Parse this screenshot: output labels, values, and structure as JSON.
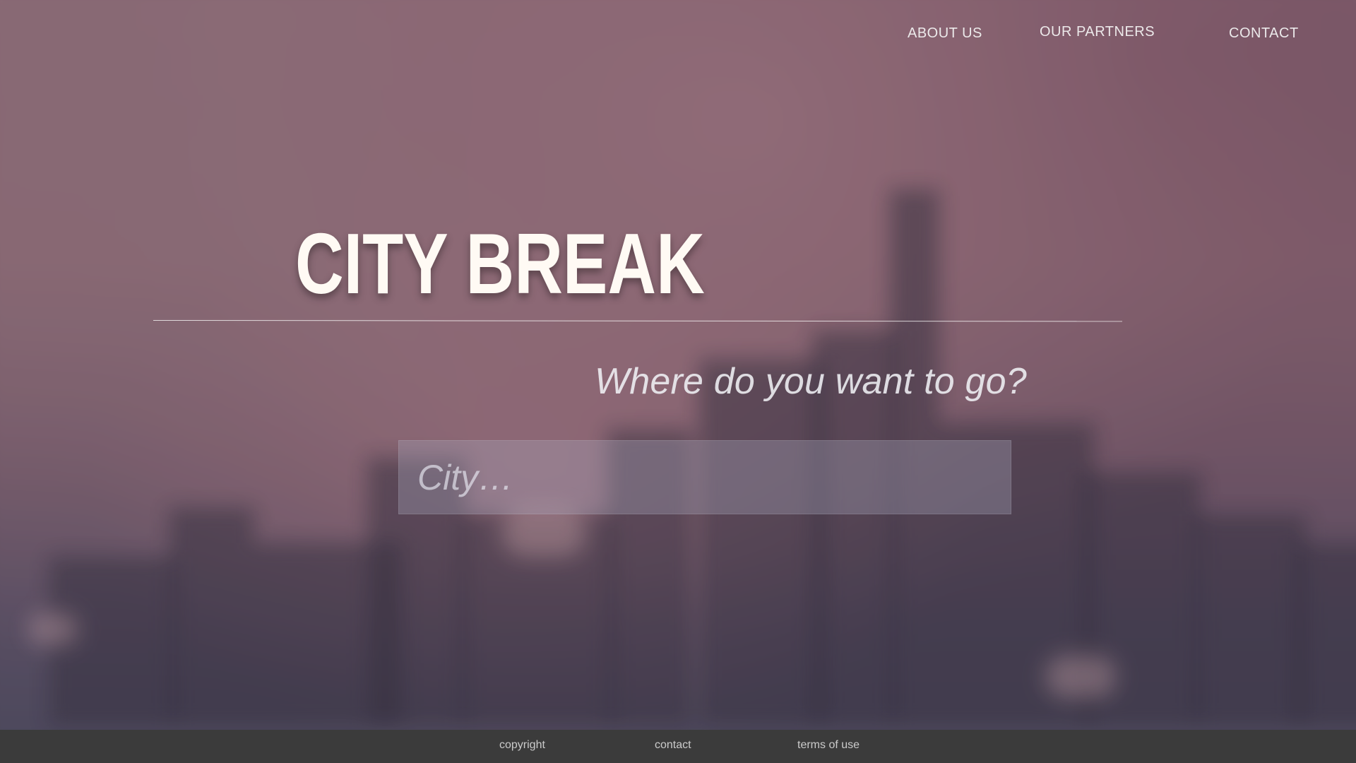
{
  "nav": {
    "items": [
      {
        "label": "ABOUT US"
      },
      {
        "label": "OUR PARTNERS"
      },
      {
        "label": "CONTACT"
      }
    ]
  },
  "hero": {
    "title": "CITY BREAK",
    "prompt": "Where do you want to go?",
    "search": {
      "placeholder": "City…",
      "value": ""
    }
  },
  "footer": {
    "links": [
      {
        "label": "copyright"
      },
      {
        "label": "contact"
      },
      {
        "label": "terms of use"
      }
    ]
  }
}
